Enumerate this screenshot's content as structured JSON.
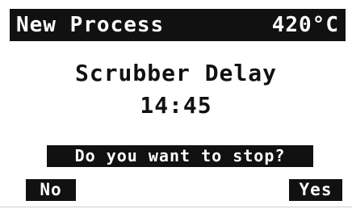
{
  "header": {
    "title": "New Process",
    "temperature": "420°C"
  },
  "process": {
    "name": "Scrubber Delay",
    "time": "14:45"
  },
  "dialog": {
    "prompt": "Do you want to stop?",
    "no_label": "No",
    "yes_label": "Yes"
  },
  "colors": {
    "background": "#ffffff",
    "foreground": "#111111",
    "inverse_text": "#ffffff"
  }
}
